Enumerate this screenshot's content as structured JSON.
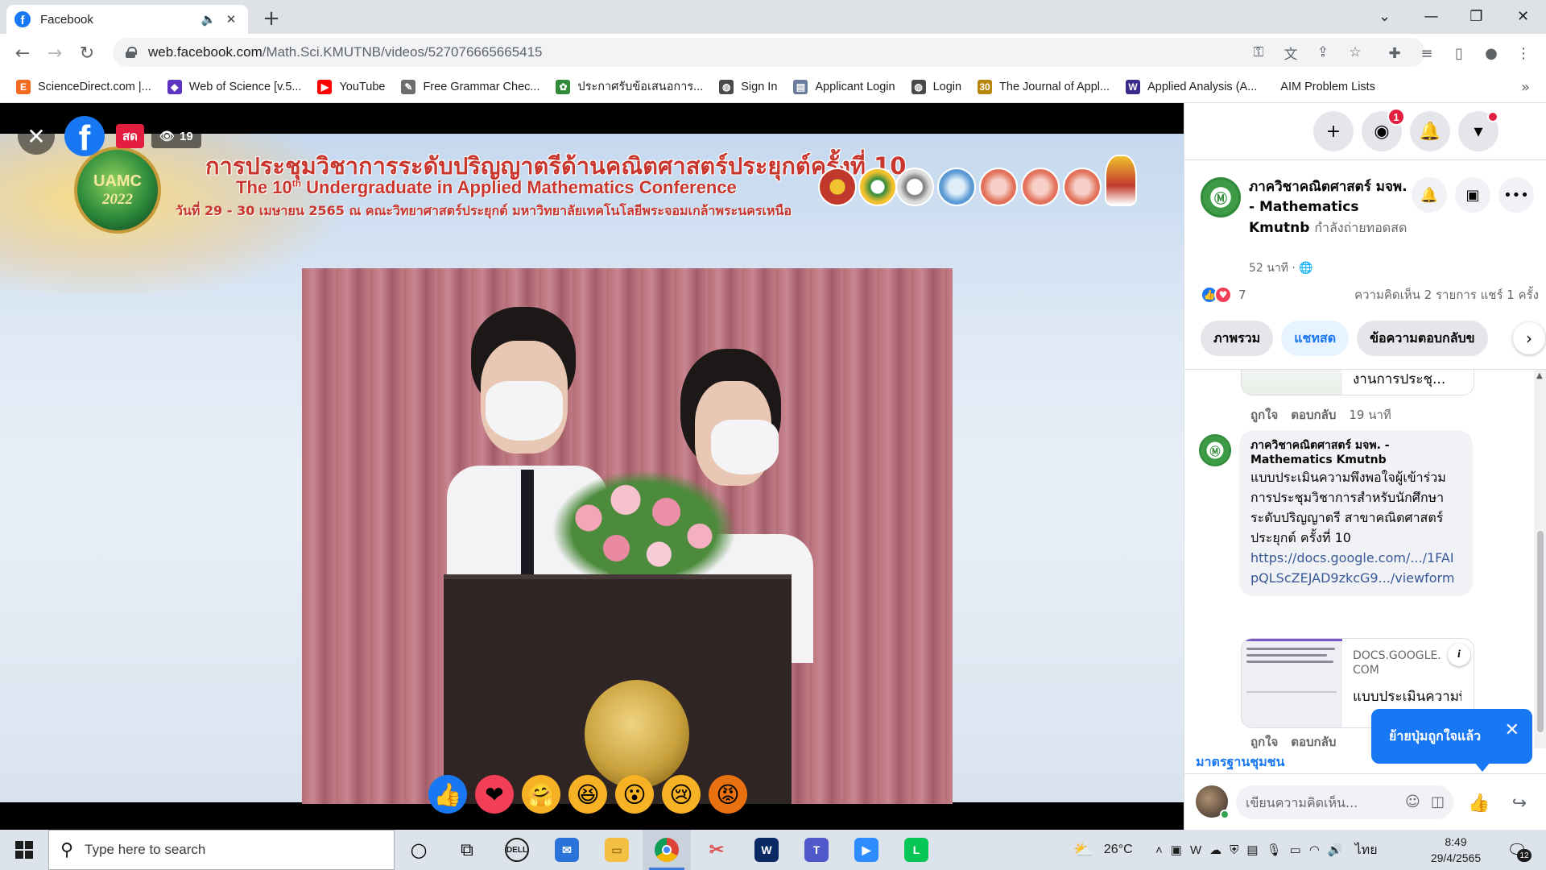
{
  "browser": {
    "tab_title": "Facebook",
    "url_host": "web.facebook.com",
    "url_path": "/Math.Sci.KMUTNB/videos/527076665665415",
    "bookmarks": [
      {
        "label": "ScienceDirect.com |...",
        "icon": "E",
        "color": "#f26b21"
      },
      {
        "label": "Web of Science [v.5...",
        "icon": "◆",
        "color": "#5e33bf"
      },
      {
        "label": "YouTube",
        "icon": "▶",
        "color": "#ff0000"
      },
      {
        "label": "Free Grammar Chec...",
        "icon": "✎",
        "color": "#6d6d6d"
      },
      {
        "label": "ประกาศรับข้อเสนอการ...",
        "icon": "✿",
        "color": "#2f8a3a"
      },
      {
        "label": "Sign In",
        "icon": "◍",
        "color": "#4a4a4a"
      },
      {
        "label": "Applicant Login",
        "icon": "▤",
        "color": "#6b7b9c"
      },
      {
        "label": "Login",
        "icon": "◍",
        "color": "#4a4a4a"
      },
      {
        "label": "The Journal of Appl...",
        "icon": "30",
        "color": "#b8860b"
      },
      {
        "label": "Applied Analysis (A...",
        "icon": "W",
        "color": "#3b2a8a"
      },
      {
        "label": "AIM Problem Lists",
        "icon": "",
        "color": "#ffffff"
      }
    ]
  },
  "video": {
    "live_label": "สด",
    "viewer_count": "19",
    "banner": {
      "logo_line1": "UAMC",
      "logo_line2": "2022",
      "title_th": "การประชุมวิชาการระดับปริญญาตรีด้านคณิตศาสตร์ประยุกต์ครั้งที่ 10",
      "title_en_prefix": "The 10",
      "title_en_sup": "th",
      "title_en_suffix": " Undergraduate in Applied Mathematics Conference",
      "date_line": "วันที่ 29 - 30 เมษายน 2565 ณ คณะวิทยาศาสตร์ประยุกต์ มหาวิทยาลัยเทคโนโลยีพระจอมเกล้าพระนครเหนือ"
    },
    "reactions": [
      {
        "name": "like",
        "glyph": "👍",
        "bg": "#1877f2"
      },
      {
        "name": "love",
        "glyph": "❤",
        "bg": "#f33e58"
      },
      {
        "name": "care",
        "glyph": "🤗",
        "bg": "#f7b125"
      },
      {
        "name": "haha",
        "glyph": "😆",
        "bg": "#f7b125"
      },
      {
        "name": "wow",
        "glyph": "😮",
        "bg": "#f7b125"
      },
      {
        "name": "sad",
        "glyph": "😢",
        "bg": "#f7b125"
      },
      {
        "name": "angry",
        "glyph": "😡",
        "bg": "#e9710f"
      }
    ]
  },
  "side": {
    "messenger_badge": "1",
    "page_name": "ภาควิชาคณิตศาสตร์ มจพ. - Mathematics Kmutnb",
    "live_status": "กำลังถ่ายทอดสด",
    "time": "52 นาที ·",
    "reaction_count": "7",
    "comment_share": "ความคิดเห็น 2 รายการ  แชร์ 1 ครั้ง",
    "pills": [
      "ภาพรวม",
      "แชทสด",
      "ข้อความตอบกลับข"
    ],
    "prev_card_title": "งานการประชุ...",
    "like_label": "ถูกใจ",
    "reply_label": "ตอบกลับ",
    "prev_time": "19 นาที",
    "comment": {
      "author": "ภาควิชาคณิตศาสตร์ มจพ. - Mathematics Kmutnb",
      "text": "แบบประเมินความพึงพอใจผู้เข้าร่วมการประชุมวิชาการสำหรับนักศึกษาระดับปริญญาตรี สาขาคณิตศาสตร์ประยุกต์ ครั้งที่ 10",
      "link": "https://docs.google.com/.../1FAIpQLScZEJAD9zkcG9.../viewform"
    },
    "link_card": {
      "domain": "DOCS.GOOGLE.COM",
      "title": "แบบประเมินความพึงพอใ..."
    },
    "tooltip": "ย้ายปุ่มถูกใจแล้ว",
    "community": "มาตรฐานชุมชน",
    "comment_placeholder": "เขียนความคิดเห็น..."
  },
  "taskbar": {
    "search_placeholder": "Type here to search",
    "temperature": "26°C",
    "lang": "ไทย",
    "time": "8:49",
    "date": "29/4/2565",
    "notif_count": "12"
  }
}
